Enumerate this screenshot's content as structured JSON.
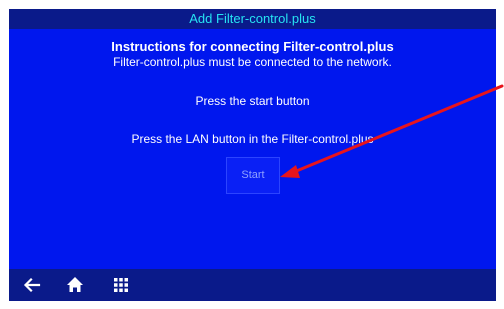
{
  "title_bar": {
    "title": "Add Filter-control.plus"
  },
  "content": {
    "heading": "Instructions for connecting Filter-control.plus",
    "subheading": "Filter-control.plus must be connected to the network.",
    "instruction_1": "Press the start button",
    "instruction_2": "Press the LAN button in the Filter-control.plus"
  },
  "start_button": {
    "label": "Start"
  },
  "bottom_nav": {
    "items": [
      {
        "icon": "back-arrow-icon"
      },
      {
        "icon": "home-icon"
      },
      {
        "icon": "apps-grid-icon"
      }
    ]
  },
  "colors": {
    "panel_background": "#0017ee",
    "bar_background": "#0a1a8a",
    "title_text": "#26e3f2",
    "annotation_arrow": "#e8141c"
  }
}
